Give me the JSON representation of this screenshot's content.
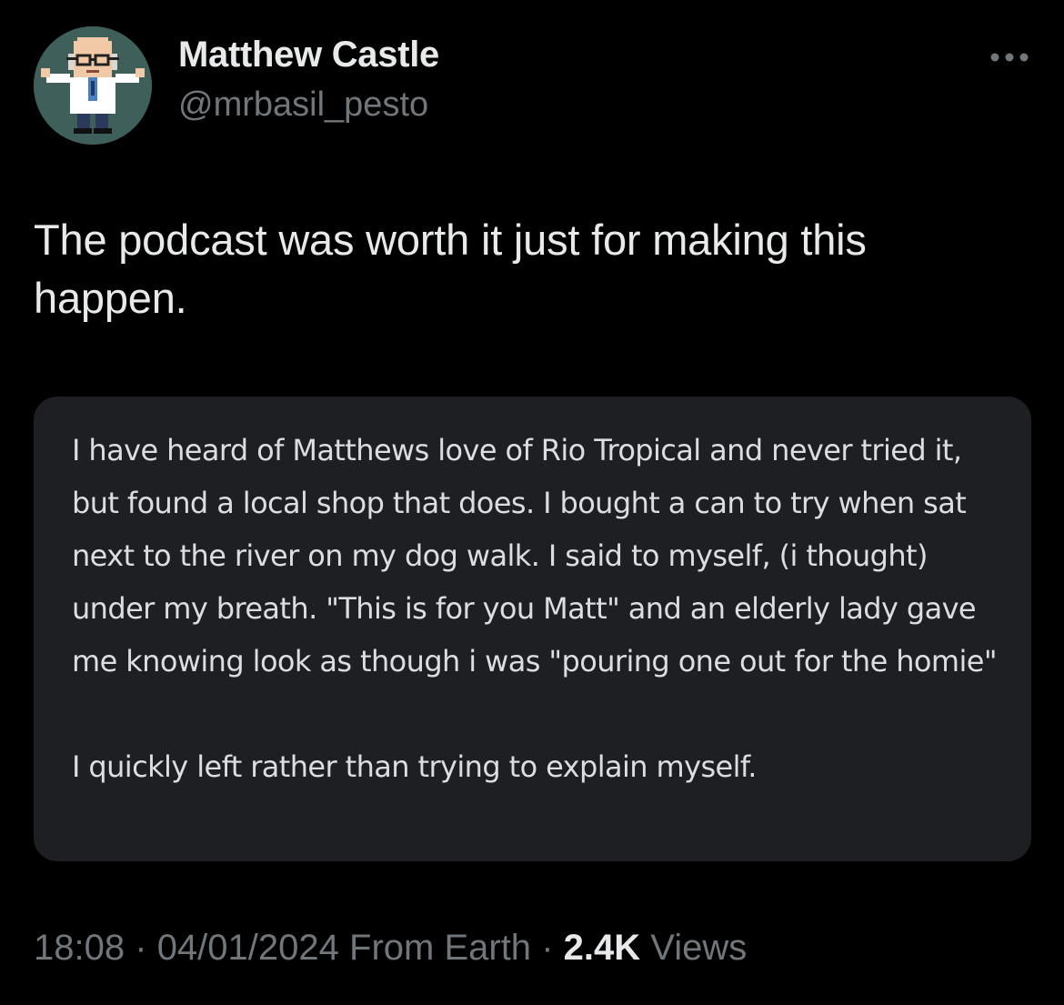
{
  "author": {
    "name": "Matthew Castle",
    "handle": "@mrbasil_pesto"
  },
  "tweet": {
    "text": "The podcast was worth it just for making this happen."
  },
  "quote": {
    "paragraph1": "I have heard of Matthews love of Rio Tropical and never tried it, but found a local shop that does. I bought a can to try when sat next to the river on my dog walk. I said to myself, (i thought) under my breath. \"This is for you Matt\" and an elderly lady gave me knowing look as though i was \"pouring one out for the homie\"",
    "paragraph2": "I quickly left rather than trying to explain myself."
  },
  "meta": {
    "time": "18:08",
    "separator": "·",
    "date": "04/01/2024",
    "source": "From Earth",
    "views_count": "2.4K",
    "views_label": "Views"
  },
  "icons": {
    "more": "more-horizontal-icon",
    "avatar": "pixel-scientist-avatar"
  },
  "colors": {
    "background": "#000000",
    "primary_text": "#e7e9ea",
    "secondary_text": "#71767b",
    "quote_background": "#1e1f22"
  }
}
